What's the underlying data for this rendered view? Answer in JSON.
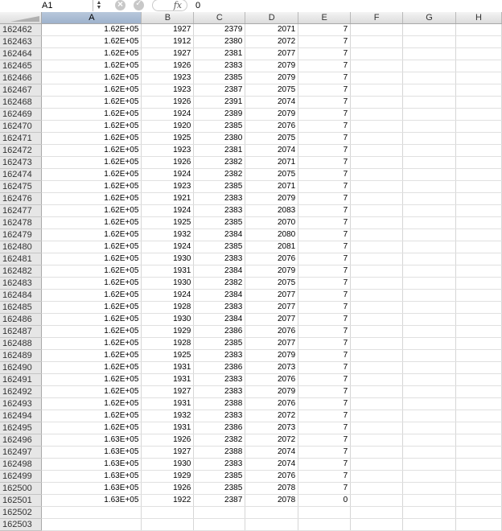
{
  "formula_bar": {
    "name_box": "A1",
    "fx_label": "fx",
    "value": "0"
  },
  "columns": [
    "A",
    "B",
    "C",
    "D",
    "E",
    "F",
    "G",
    "H"
  ],
  "rows": [
    {
      "n": "162462",
      "a": "1.62E+05",
      "b": "1927",
      "c": "2379",
      "d": "2071",
      "e": "7"
    },
    {
      "n": "162463",
      "a": "1.62E+05",
      "b": "1912",
      "c": "2380",
      "d": "2072",
      "e": "7"
    },
    {
      "n": "162464",
      "a": "1.62E+05",
      "b": "1927",
      "c": "2381",
      "d": "2077",
      "e": "7"
    },
    {
      "n": "162465",
      "a": "1.62E+05",
      "b": "1926",
      "c": "2383",
      "d": "2079",
      "e": "7"
    },
    {
      "n": "162466",
      "a": "1.62E+05",
      "b": "1923",
      "c": "2385",
      "d": "2079",
      "e": "7"
    },
    {
      "n": "162467",
      "a": "1.62E+05",
      "b": "1923",
      "c": "2387",
      "d": "2075",
      "e": "7"
    },
    {
      "n": "162468",
      "a": "1.62E+05",
      "b": "1926",
      "c": "2391",
      "d": "2074",
      "e": "7"
    },
    {
      "n": "162469",
      "a": "1.62E+05",
      "b": "1924",
      "c": "2389",
      "d": "2079",
      "e": "7"
    },
    {
      "n": "162470",
      "a": "1.62E+05",
      "b": "1920",
      "c": "2385",
      "d": "2076",
      "e": "7"
    },
    {
      "n": "162471",
      "a": "1.62E+05",
      "b": "1925",
      "c": "2380",
      "d": "2075",
      "e": "7"
    },
    {
      "n": "162472",
      "a": "1.62E+05",
      "b": "1923",
      "c": "2381",
      "d": "2074",
      "e": "7"
    },
    {
      "n": "162473",
      "a": "1.62E+05",
      "b": "1926",
      "c": "2382",
      "d": "2071",
      "e": "7"
    },
    {
      "n": "162474",
      "a": "1.62E+05",
      "b": "1924",
      "c": "2382",
      "d": "2075",
      "e": "7"
    },
    {
      "n": "162475",
      "a": "1.62E+05",
      "b": "1923",
      "c": "2385",
      "d": "2071",
      "e": "7"
    },
    {
      "n": "162476",
      "a": "1.62E+05",
      "b": "1921",
      "c": "2383",
      "d": "2079",
      "e": "7"
    },
    {
      "n": "162477",
      "a": "1.62E+05",
      "b": "1924",
      "c": "2383",
      "d": "2083",
      "e": "7"
    },
    {
      "n": "162478",
      "a": "1.62E+05",
      "b": "1925",
      "c": "2385",
      "d": "2070",
      "e": "7"
    },
    {
      "n": "162479",
      "a": "1.62E+05",
      "b": "1932",
      "c": "2384",
      "d": "2080",
      "e": "7"
    },
    {
      "n": "162480",
      "a": "1.62E+05",
      "b": "1924",
      "c": "2385",
      "d": "2081",
      "e": "7"
    },
    {
      "n": "162481",
      "a": "1.62E+05",
      "b": "1930",
      "c": "2383",
      "d": "2076",
      "e": "7"
    },
    {
      "n": "162482",
      "a": "1.62E+05",
      "b": "1931",
      "c": "2384",
      "d": "2079",
      "e": "7"
    },
    {
      "n": "162483",
      "a": "1.62E+05",
      "b": "1930",
      "c": "2382",
      "d": "2075",
      "e": "7"
    },
    {
      "n": "162484",
      "a": "1.62E+05",
      "b": "1924",
      "c": "2384",
      "d": "2077",
      "e": "7"
    },
    {
      "n": "162485",
      "a": "1.62E+05",
      "b": "1928",
      "c": "2383",
      "d": "2077",
      "e": "7"
    },
    {
      "n": "162486",
      "a": "1.62E+05",
      "b": "1930",
      "c": "2384",
      "d": "2077",
      "e": "7"
    },
    {
      "n": "162487",
      "a": "1.62E+05",
      "b": "1929",
      "c": "2386",
      "d": "2076",
      "e": "7"
    },
    {
      "n": "162488",
      "a": "1.62E+05",
      "b": "1928",
      "c": "2385",
      "d": "2077",
      "e": "7"
    },
    {
      "n": "162489",
      "a": "1.62E+05",
      "b": "1925",
      "c": "2383",
      "d": "2079",
      "e": "7"
    },
    {
      "n": "162490",
      "a": "1.62E+05",
      "b": "1931",
      "c": "2386",
      "d": "2073",
      "e": "7"
    },
    {
      "n": "162491",
      "a": "1.62E+05",
      "b": "1931",
      "c": "2383",
      "d": "2076",
      "e": "7"
    },
    {
      "n": "162492",
      "a": "1.62E+05",
      "b": "1927",
      "c": "2383",
      "d": "2079",
      "e": "7"
    },
    {
      "n": "162493",
      "a": "1.62E+05",
      "b": "1931",
      "c": "2388",
      "d": "2076",
      "e": "7"
    },
    {
      "n": "162494",
      "a": "1.62E+05",
      "b": "1932",
      "c": "2383",
      "d": "2072",
      "e": "7"
    },
    {
      "n": "162495",
      "a": "1.62E+05",
      "b": "1931",
      "c": "2386",
      "d": "2073",
      "e": "7"
    },
    {
      "n": "162496",
      "a": "1.63E+05",
      "b": "1926",
      "c": "2382",
      "d": "2072",
      "e": "7"
    },
    {
      "n": "162497",
      "a": "1.63E+05",
      "b": "1927",
      "c": "2388",
      "d": "2074",
      "e": "7"
    },
    {
      "n": "162498",
      "a": "1.63E+05",
      "b": "1930",
      "c": "2383",
      "d": "2074",
      "e": "7"
    },
    {
      "n": "162499",
      "a": "1.63E+05",
      "b": "1929",
      "c": "2385",
      "d": "2076",
      "e": "7"
    },
    {
      "n": "162500",
      "a": "1.63E+05",
      "b": "1926",
      "c": "2385",
      "d": "2078",
      "e": "7"
    },
    {
      "n": "162501",
      "a": "1.63E+05",
      "b": "1922",
      "c": "2387",
      "d": "2078",
      "e": "0"
    },
    {
      "n": "162502",
      "a": "",
      "b": "",
      "c": "",
      "d": "",
      "e": ""
    },
    {
      "n": "162503",
      "a": "",
      "b": "",
      "c": "",
      "d": "",
      "e": ""
    }
  ]
}
